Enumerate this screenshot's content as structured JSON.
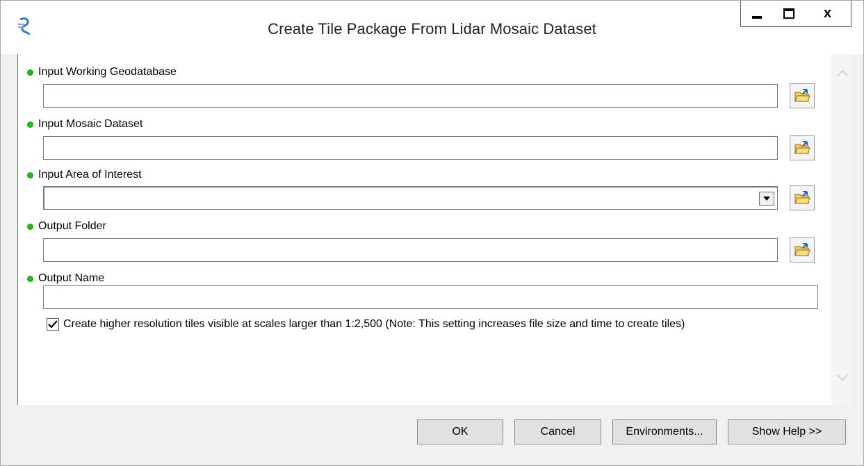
{
  "window": {
    "title": "Create Tile Package From Lidar Mosaic Dataset",
    "close_label": "x"
  },
  "fields": [
    {
      "label": "Input Working Geodatabase",
      "value": ""
    },
    {
      "label": "Input Mosaic Dataset",
      "value": ""
    },
    {
      "label": "Input Area of Interest",
      "value": ""
    },
    {
      "label": "Output Folder",
      "value": ""
    },
    {
      "label": "Output Name",
      "value": ""
    }
  ],
  "options": {
    "high_res_checked": true,
    "high_res_label": "Create higher resolution tiles visible at scales larger than 1:2,500 (Note: This setting increases file size and time to create tiles)"
  },
  "buttons": {
    "ok": "OK",
    "cancel": "Cancel",
    "environments": "Environments...",
    "show_help": "Show Help >>"
  },
  "icons": {
    "app": "toolbox-script-icon",
    "browse": "open-folder-icon",
    "required": "green-dot-icon"
  },
  "colors": {
    "required_dot": "#1fbf1f",
    "folder": "#f2cf5b"
  }
}
